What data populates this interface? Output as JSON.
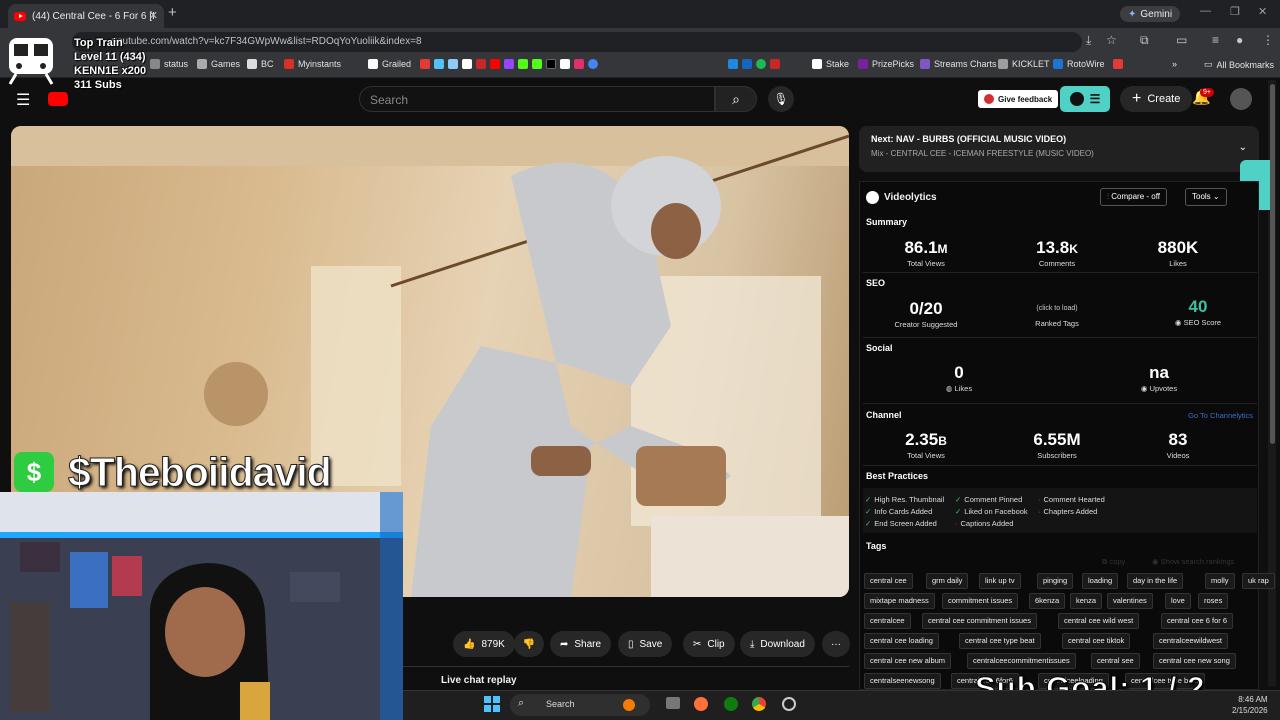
{
  "browser": {
    "tab_title": "(44) Central Cee - 6 For 6 [I",
    "new_tab": "+",
    "gemini": "Gemini",
    "url": "youtube.com/watch?v=kc7F34GWpWw&list=RDOqYoYuoliik&index=8",
    "bookmarks": [
      "status",
      "Games",
      "BC",
      "Myinstants",
      "Grailed",
      "Stake",
      "PrizePicks",
      "Streams Charts",
      "KICKLET",
      "RotoWire"
    ],
    "all_bookmarks": "All Bookmarks"
  },
  "stream_overlay": {
    "line1": "Top Train",
    "line2": "Level 11  (434)",
    "line3": "KENN1E x200",
    "line4": "311 Subs",
    "donation_name": "$Theboiidavid",
    "sub_goal": "Sub Goal:  1 / 2"
  },
  "youtube": {
    "search_placeholder": "Search",
    "give_feedback": "Give feedback",
    "create": "Create",
    "notification_count": "9+",
    "like_count": "879K",
    "share": "Share",
    "save": "Save",
    "clip": "Clip",
    "download": "Download",
    "more": "···",
    "live_chat": "Live chat replay",
    "next_title": "Next: NAV - BURBS (OFFICIAL MUSIC VIDEO)",
    "next_sub": "Mix - CENTRAL CEE - ICEMAN FREESTYLE (MUSIC VIDEO)"
  },
  "videolytics": {
    "brand": "Videolytics",
    "compare": "Compare - off",
    "tools": "Tools",
    "summary_label": "Summary",
    "summary": [
      {
        "value": "86.1",
        "unit": "M",
        "label": "Total Views"
      },
      {
        "value": "13.8",
        "unit": "K",
        "label": "Comments"
      },
      {
        "value": "880K",
        "unit": "",
        "label": "Likes"
      }
    ],
    "seo_label": "SEO",
    "seo": {
      "creator_suggested": "0/20",
      "creator_label": "Creator Suggested",
      "ranked_hint": "(click to load)",
      "ranked_label": "Ranked Tags",
      "seo_score": "40",
      "seo_score_label": "SEO Score"
    },
    "social_label": "Social",
    "social": {
      "likes": "0",
      "likes_label": "Likes",
      "upvotes": "na",
      "upvotes_label": "Upvotes"
    },
    "channel_label": "Channel",
    "channel_link": "Go To Channelytics",
    "channel": [
      {
        "value": "2.35",
        "unit": "B",
        "label": "Total Views"
      },
      {
        "value": "6.55M",
        "unit": "",
        "label": "Subscribers"
      },
      {
        "value": "83",
        "unit": "",
        "label": "Videos"
      }
    ],
    "best_practices_label": "Best Practices",
    "best_practices": [
      {
        "text": "High Res. Thumbnail",
        "ok": true
      },
      {
        "text": "Comment Pinned",
        "ok": true
      },
      {
        "text": "Comment Hearted",
        "ok": false
      },
      {
        "text": "Info Cards Added",
        "ok": true
      },
      {
        "text": "Liked on Facebook",
        "ok": true
      },
      {
        "text": "Chapters Added",
        "ok": false
      },
      {
        "text": "End Screen Added",
        "ok": true
      },
      {
        "text": "Captions Added",
        "ok": false
      }
    ],
    "tags_label": "Tags",
    "tags_copy": "copy",
    "tags_show": "Show search rankings",
    "tags": [
      [
        "central cee",
        "grm daily",
        "link up tv",
        "pinging",
        "loading",
        "day in the life",
        "molly",
        "uk rap"
      ],
      [
        "mixtape madness",
        "commitment issues",
        "6kenza",
        "kenza",
        "valentines",
        "love",
        "roses"
      ],
      [
        "centralcee",
        "central cee commitment issues",
        "central cee wild west",
        "central cee 6 for 6"
      ],
      [
        "central cee loading",
        "central cee type beat",
        "central cee tiktok",
        "centralceewildwest"
      ],
      [
        "central cee new album",
        "centralceecommitmentissues",
        "central see",
        "central cee new song"
      ],
      [
        "centralseenewsong",
        "central cee 6for6",
        "centralceeloading",
        "centralcee type beat"
      ]
    ]
  },
  "taskbar": {
    "search": "Search",
    "time": "8:46 AM",
    "date": "2/15/2026"
  }
}
